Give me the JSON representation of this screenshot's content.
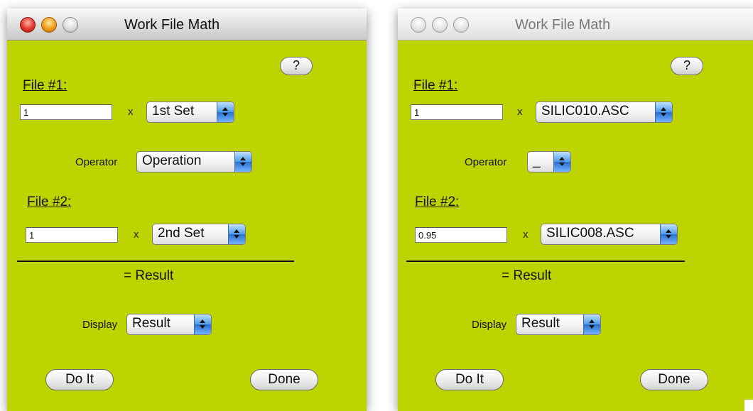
{
  "windows": [
    {
      "title": "Work File Math",
      "active": true,
      "help_label": "?",
      "file1": {
        "label": "File #1:",
        "factor": "1",
        "mult": "x",
        "set": "1st Set"
      },
      "operator": {
        "label": "Operator",
        "value": "Operation"
      },
      "file2": {
        "label": "File #2:",
        "factor": "1",
        "mult": "x",
        "set": "2nd Set"
      },
      "result_label": "= Result",
      "display": {
        "label": "Display",
        "value": "Result"
      },
      "do_it_label": "Do It",
      "done_label": "Done"
    },
    {
      "title": "Work File Math",
      "active": false,
      "help_label": "?",
      "file1": {
        "label": "File #1:",
        "factor": "1",
        "mult": "x",
        "set": "SILIC010.ASC"
      },
      "operator": {
        "label": "Operator",
        "value": "_"
      },
      "file2": {
        "label": "File #2:",
        "factor": "0.95",
        "mult": "x",
        "set": "SILIC008.ASC"
      },
      "result_label": "= Result",
      "display": {
        "label": "Display",
        "value": "Result"
      },
      "do_it_label": "Do It",
      "done_label": "Done"
    }
  ],
  "colors": {
    "window_background": "#bdd400",
    "popup_arrow_blue": "#4d9ae8",
    "close_red": "#e0342a",
    "minimize_orange": "#f09a18"
  },
  "icons": [
    "close-icon",
    "minimize-icon",
    "zoom-icon",
    "popup-arrows-icon"
  ]
}
